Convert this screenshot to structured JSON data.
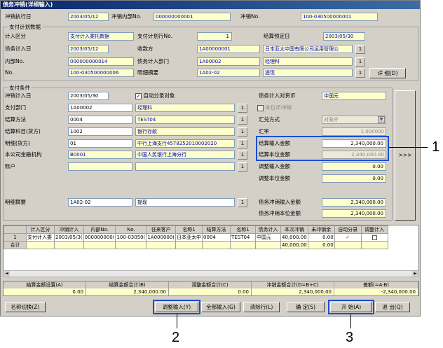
{
  "window": {
    "title": "债务冲销(详细输入)"
  },
  "header": {
    "exec_date_label": "冲销执行日",
    "exec_date": "2003/05/12",
    "internal_no_label": "冲销内部No.",
    "internal_no": "000000000001",
    "no_label": "冲销No.",
    "no": "100-030500000001"
  },
  "plan": {
    "group_title": "支付计划数据",
    "category_label": "计入区分",
    "category": "支付计入委托数据",
    "exec_no_label": "支付计划行No.",
    "exec_no": "1",
    "settle_date_label": "结算预定日",
    "settle_date": "2003/05/30",
    "debt_date_label": "债务计入日",
    "debt_date": "2003/05/12",
    "payee_label": "收款方",
    "payee_code": "1A00000001",
    "payee_name": "日本亚太中国有限公司运用管理公",
    "internal_no_label": "内部No.",
    "internal_no": "000000000014",
    "dept_label": "债务计入部门",
    "dept_code": "1A00002",
    "dept_name": "经理科",
    "no_label": "No.",
    "no": "100-030500000006",
    "summary_label": "明细摘要",
    "summary_code": "1A02-02",
    "summary_name": "提现",
    "detail_button": "详 细(D)"
  },
  "cond": {
    "group_title": "支付条件",
    "offset_date_label": "冲销计入日",
    "offset_date": "2003/05/30",
    "auto_class_label": "自动分录对象",
    "pay_dept_label": "支付部门",
    "pay_dept_code": "1A00002",
    "pay_dept_name": "经理科",
    "method_label": "结算方法",
    "method_code": "0004",
    "method_name": "TEST04",
    "subject_label": "结算科目(货方)",
    "subject_code": "1002",
    "subject_name": "银行存款",
    "detail_label": "明细(货方)",
    "detail_code": "01",
    "detail_name": "中行上海支行4578252010002020",
    "bank_label": "本公司金融机构",
    "bank_code": "B0001",
    "bank_name": "中国人民银行上海分行",
    "account_label": "账户",
    "summary_label": "明细摘要",
    "summary_code": "1A02-02",
    "summary_name": "提现",
    "currency_label": "债务计入对货币",
    "currency": "中国元",
    "local_offset_label": "本位币冲销",
    "fx_method_label": "汇兑方式",
    "fx_method": "对象外",
    "rate_label": "汇率",
    "rate": "1.000000",
    "settle_input_label": "结算输入金额",
    "settle_input": "2,340,000.00",
    "settle_local_label": "结算本位金额",
    "settle_local": "2,340,000.00",
    "adj_input_label": "调整输入金额",
    "adj_input": "0.00",
    "adj_local_label": "调整本位金额",
    "adj_local": "0.00",
    "debt_input_label": "债务冲销输入金额",
    "debt_input": "2,340,000.00",
    "debt_local_label": "债务冲销本位金额",
    "debt_local": "2,340,000.00",
    "arrow_button": ">>>"
  },
  "grid": {
    "headers": [
      "",
      "计入区分",
      "冲销计入",
      "内部No.",
      "No.",
      "往来客户",
      "名称1",
      "结算方法",
      "名称1",
      "债务计入",
      "本次冲销",
      "未冲销余",
      "自动分录",
      "调整计入"
    ],
    "rows": [
      [
        "1",
        "支付计入委",
        "2003/05/3(",
        "000000000(",
        "100-03050(",
        "1A000000(",
        "日本亚太中",
        "0004",
        "TEST04",
        "中国元",
        "40,000.00",
        "0.00",
        "",
        ""
      ]
    ],
    "total_label": "合计",
    "total_row": [
      "",
      "",
      "",
      "",
      "",
      "",
      "",
      "",
      "",
      "",
      "40,000.00",
      "0.00",
      "",
      ""
    ]
  },
  "summary": {
    "labels": [
      "结算金额设置(A)",
      "结算金额合计(B)",
      "调整金额合计(C)",
      "冲销金额合计(D=B+C)",
      "差额(=A-B)"
    ],
    "values": [
      "0.00",
      "2,340,000.00",
      "0.00",
      "2,340,000.00",
      "-2,340,000.00"
    ]
  },
  "buttons": {
    "name_switch": "名称切换(Z)",
    "adjust_input": "调整输入(Y)",
    "all_input": "全部输入(G)",
    "clear_row": "清除行(L)",
    "confirm": "确 定(S)",
    "start": "开 始(A)",
    "exit": "退 出(Q)"
  },
  "callouts": {
    "c1": "1",
    "c2": "2",
    "c3": "3"
  }
}
